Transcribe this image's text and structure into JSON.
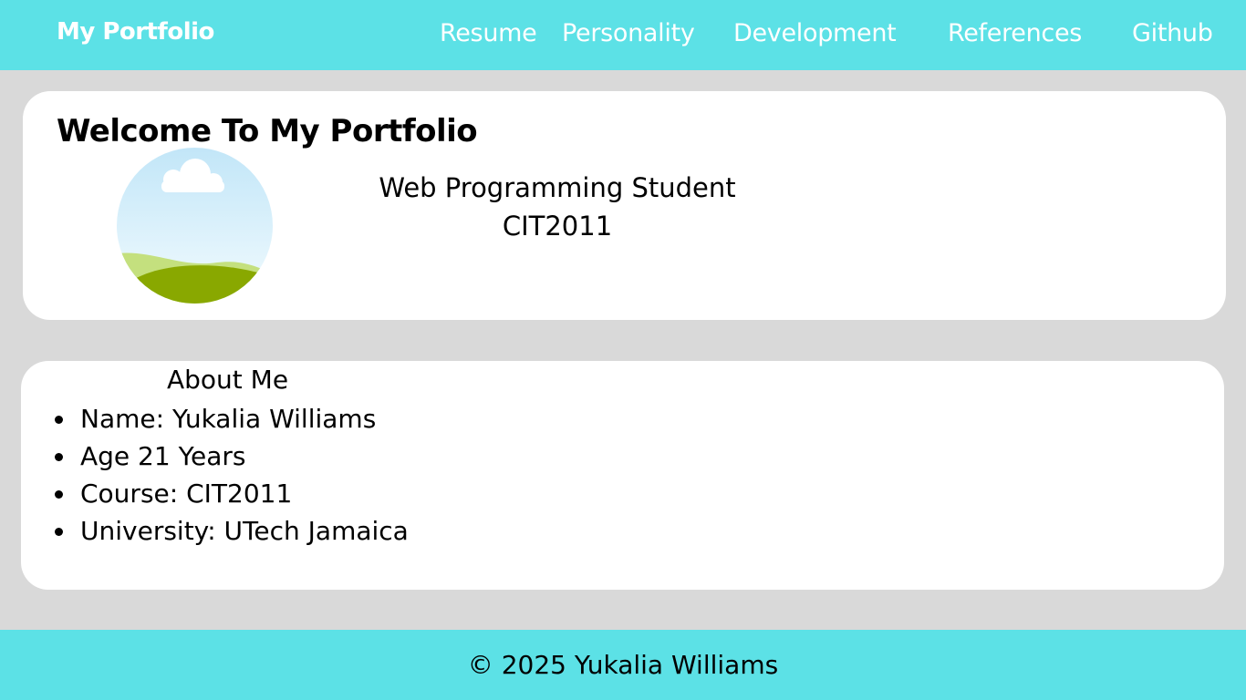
{
  "header": {
    "brand": "My Portfolio",
    "nav": [
      {
        "label": "Resume"
      },
      {
        "label": "Personality"
      },
      {
        "label": "Development"
      },
      {
        "label": "References"
      },
      {
        "label": "Github"
      }
    ]
  },
  "welcome": {
    "title": "Welcome To My Portfolio",
    "role": "Web Programming Student",
    "course": "CIT2011",
    "avatar_icon": "landscape-placeholder-image"
  },
  "about": {
    "title": "About Me",
    "items": [
      " Name: Yukalia Williams",
      "Age 21 Years",
      "Course: CIT2011",
      "University: UTech Jamaica"
    ]
  },
  "footer": {
    "copyright": "© 2025 Yukalia Williams"
  },
  "colors": {
    "header_bg": "#5ce1e6",
    "page_bg": "#d9d9d9",
    "card_bg": "#ffffff"
  }
}
